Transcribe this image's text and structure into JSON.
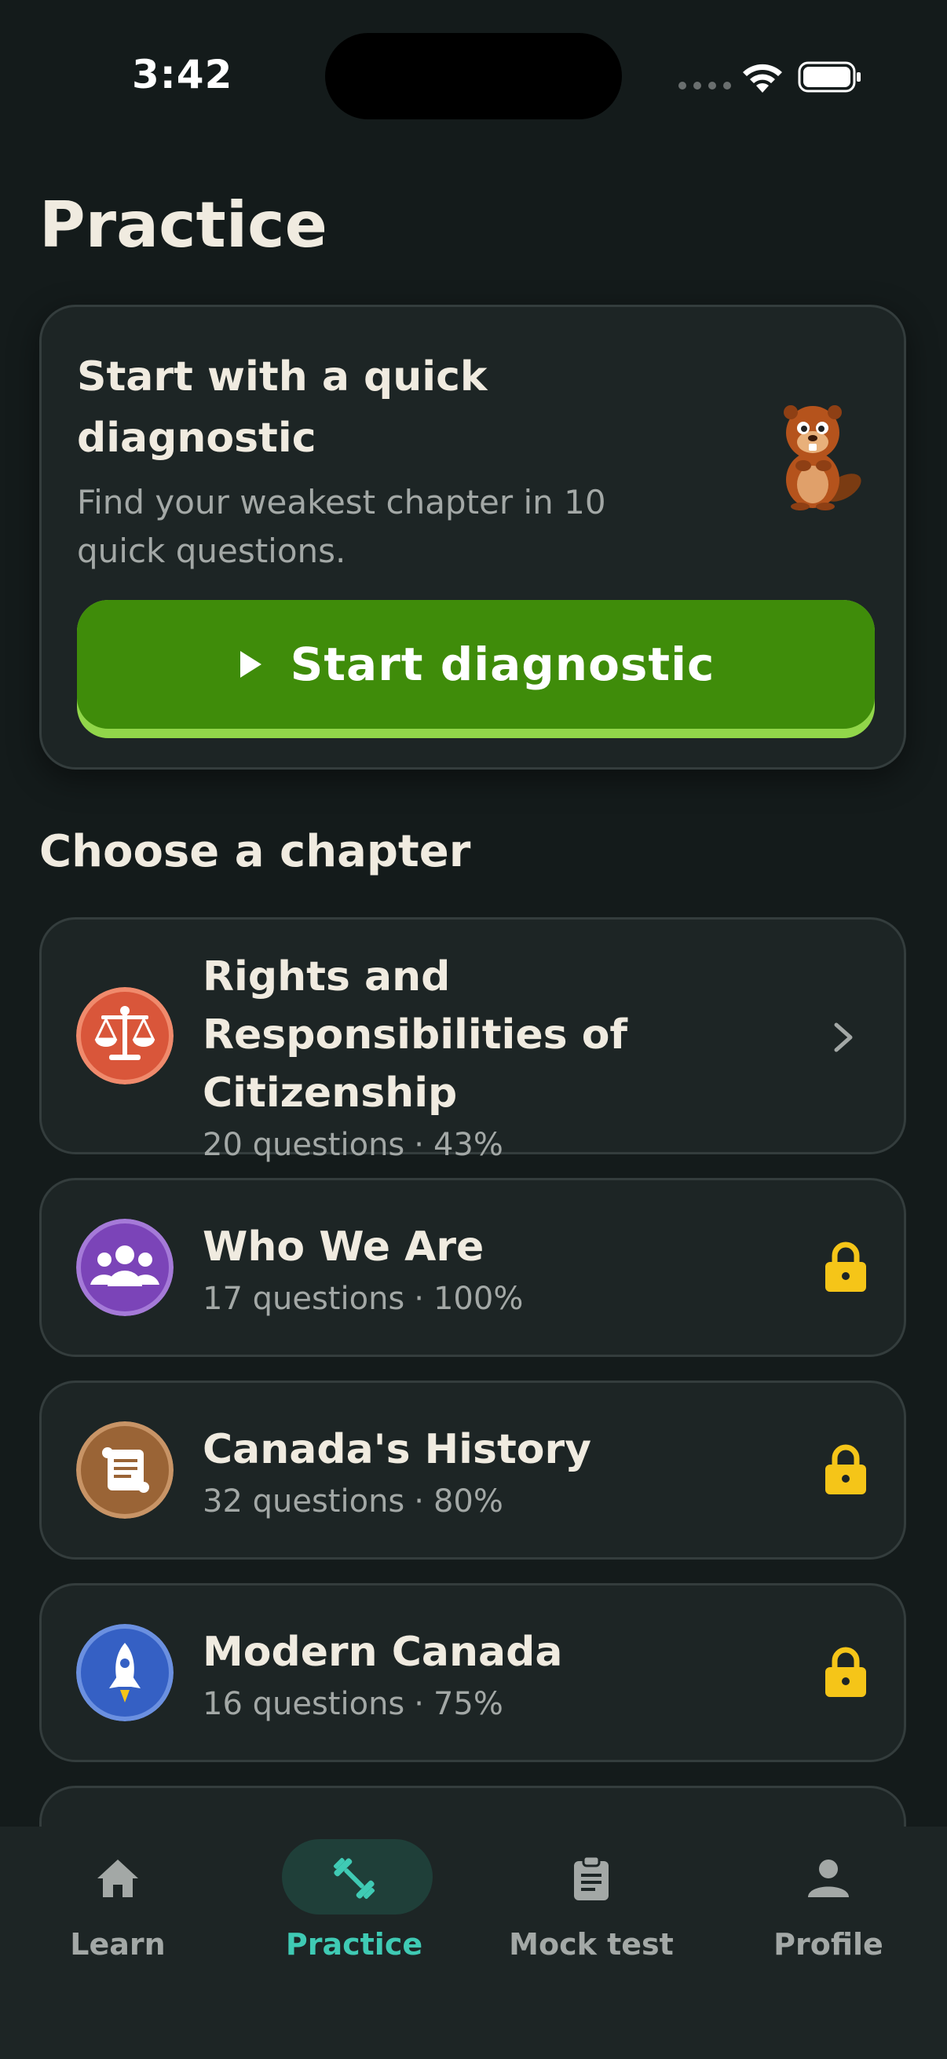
{
  "status_bar": {
    "time": "3:42"
  },
  "page": {
    "title": "Practice"
  },
  "diagnostic": {
    "title": "Start with a quick diagnostic",
    "subtitle": "Find your weakest chapter in 10 quick questions.",
    "button_label": "Start diagnostic",
    "button_icon": "play-icon",
    "mascot": "beaver-mascot"
  },
  "section": {
    "title": "Choose a chapter"
  },
  "chapters": [
    {
      "title": "Rights and Responsibilities of Citizenship",
      "questions": "20 questions",
      "progress": "43%",
      "progress_value": 0.43,
      "icon": "scales-icon",
      "color": "#d9563a",
      "state": "open"
    },
    {
      "title": "Who We Are",
      "questions": "17 questions",
      "progress": "100%",
      "progress_value": 1.0,
      "icon": "people-icon",
      "color": "#7b44b8",
      "state": "locked"
    },
    {
      "title": "Canada's History",
      "questions": "32 questions",
      "progress": "80%",
      "progress_value": 0.8,
      "icon": "scroll-icon",
      "color": "#9a6436",
      "state": "locked"
    },
    {
      "title": "Modern Canada",
      "questions": "16 questions",
      "progress": "75%",
      "progress_value": 0.75,
      "icon": "rocket-icon",
      "color": "#3560c4",
      "state": "locked"
    }
  ],
  "meta_separator": "·",
  "tab_bar": {
    "active": "Practice",
    "tabs": [
      {
        "label": "Learn",
        "icon": "home-icon"
      },
      {
        "label": "Practice",
        "icon": "dumbbell-icon"
      },
      {
        "label": "Mock test",
        "icon": "clipboard-icon"
      },
      {
        "label": "Profile",
        "icon": "person-icon"
      }
    ]
  },
  "colors": {
    "background": "#141b1b",
    "card": "#1d2525",
    "accent_green": "#3f8c0a",
    "active_tab": "#3fcab4",
    "lock": "#f5c518"
  }
}
